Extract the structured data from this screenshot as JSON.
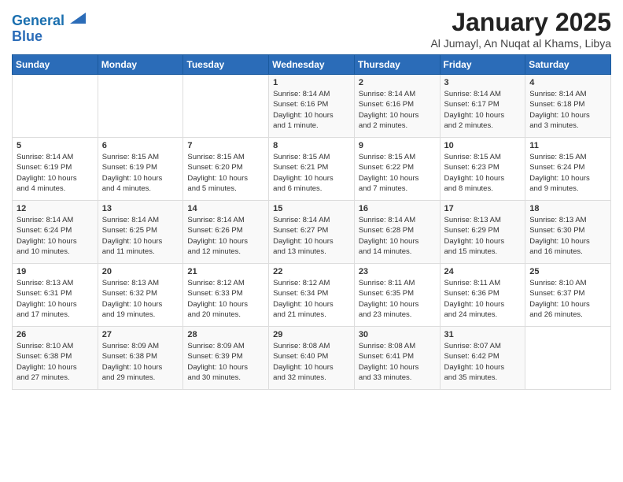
{
  "logo": {
    "line1": "General",
    "line2": "Blue"
  },
  "title": "January 2025",
  "subtitle": "Al Jumayl, An Nuqat al Khams, Libya",
  "days_of_week": [
    "Sunday",
    "Monday",
    "Tuesday",
    "Wednesday",
    "Thursday",
    "Friday",
    "Saturday"
  ],
  "weeks": [
    [
      {
        "day": "",
        "info": ""
      },
      {
        "day": "",
        "info": ""
      },
      {
        "day": "",
        "info": ""
      },
      {
        "day": "1",
        "info": "Sunrise: 8:14 AM\nSunset: 6:16 PM\nDaylight: 10 hours\nand 1 minute."
      },
      {
        "day": "2",
        "info": "Sunrise: 8:14 AM\nSunset: 6:16 PM\nDaylight: 10 hours\nand 2 minutes."
      },
      {
        "day": "3",
        "info": "Sunrise: 8:14 AM\nSunset: 6:17 PM\nDaylight: 10 hours\nand 2 minutes."
      },
      {
        "day": "4",
        "info": "Sunrise: 8:14 AM\nSunset: 6:18 PM\nDaylight: 10 hours\nand 3 minutes."
      }
    ],
    [
      {
        "day": "5",
        "info": "Sunrise: 8:14 AM\nSunset: 6:19 PM\nDaylight: 10 hours\nand 4 minutes."
      },
      {
        "day": "6",
        "info": "Sunrise: 8:15 AM\nSunset: 6:19 PM\nDaylight: 10 hours\nand 4 minutes."
      },
      {
        "day": "7",
        "info": "Sunrise: 8:15 AM\nSunset: 6:20 PM\nDaylight: 10 hours\nand 5 minutes."
      },
      {
        "day": "8",
        "info": "Sunrise: 8:15 AM\nSunset: 6:21 PM\nDaylight: 10 hours\nand 6 minutes."
      },
      {
        "day": "9",
        "info": "Sunrise: 8:15 AM\nSunset: 6:22 PM\nDaylight: 10 hours\nand 7 minutes."
      },
      {
        "day": "10",
        "info": "Sunrise: 8:15 AM\nSunset: 6:23 PM\nDaylight: 10 hours\nand 8 minutes."
      },
      {
        "day": "11",
        "info": "Sunrise: 8:15 AM\nSunset: 6:24 PM\nDaylight: 10 hours\nand 9 minutes."
      }
    ],
    [
      {
        "day": "12",
        "info": "Sunrise: 8:14 AM\nSunset: 6:24 PM\nDaylight: 10 hours\nand 10 minutes."
      },
      {
        "day": "13",
        "info": "Sunrise: 8:14 AM\nSunset: 6:25 PM\nDaylight: 10 hours\nand 11 minutes."
      },
      {
        "day": "14",
        "info": "Sunrise: 8:14 AM\nSunset: 6:26 PM\nDaylight: 10 hours\nand 12 minutes."
      },
      {
        "day": "15",
        "info": "Sunrise: 8:14 AM\nSunset: 6:27 PM\nDaylight: 10 hours\nand 13 minutes."
      },
      {
        "day": "16",
        "info": "Sunrise: 8:14 AM\nSunset: 6:28 PM\nDaylight: 10 hours\nand 14 minutes."
      },
      {
        "day": "17",
        "info": "Sunrise: 8:13 AM\nSunset: 6:29 PM\nDaylight: 10 hours\nand 15 minutes."
      },
      {
        "day": "18",
        "info": "Sunrise: 8:13 AM\nSunset: 6:30 PM\nDaylight: 10 hours\nand 16 minutes."
      }
    ],
    [
      {
        "day": "19",
        "info": "Sunrise: 8:13 AM\nSunset: 6:31 PM\nDaylight: 10 hours\nand 17 minutes."
      },
      {
        "day": "20",
        "info": "Sunrise: 8:13 AM\nSunset: 6:32 PM\nDaylight: 10 hours\nand 19 minutes."
      },
      {
        "day": "21",
        "info": "Sunrise: 8:12 AM\nSunset: 6:33 PM\nDaylight: 10 hours\nand 20 minutes."
      },
      {
        "day": "22",
        "info": "Sunrise: 8:12 AM\nSunset: 6:34 PM\nDaylight: 10 hours\nand 21 minutes."
      },
      {
        "day": "23",
        "info": "Sunrise: 8:11 AM\nSunset: 6:35 PM\nDaylight: 10 hours\nand 23 minutes."
      },
      {
        "day": "24",
        "info": "Sunrise: 8:11 AM\nSunset: 6:36 PM\nDaylight: 10 hours\nand 24 minutes."
      },
      {
        "day": "25",
        "info": "Sunrise: 8:10 AM\nSunset: 6:37 PM\nDaylight: 10 hours\nand 26 minutes."
      }
    ],
    [
      {
        "day": "26",
        "info": "Sunrise: 8:10 AM\nSunset: 6:38 PM\nDaylight: 10 hours\nand 27 minutes."
      },
      {
        "day": "27",
        "info": "Sunrise: 8:09 AM\nSunset: 6:38 PM\nDaylight: 10 hours\nand 29 minutes."
      },
      {
        "day": "28",
        "info": "Sunrise: 8:09 AM\nSunset: 6:39 PM\nDaylight: 10 hours\nand 30 minutes."
      },
      {
        "day": "29",
        "info": "Sunrise: 8:08 AM\nSunset: 6:40 PM\nDaylight: 10 hours\nand 32 minutes."
      },
      {
        "day": "30",
        "info": "Sunrise: 8:08 AM\nSunset: 6:41 PM\nDaylight: 10 hours\nand 33 minutes."
      },
      {
        "day": "31",
        "info": "Sunrise: 8:07 AM\nSunset: 6:42 PM\nDaylight: 10 hours\nand 35 minutes."
      },
      {
        "day": "",
        "info": ""
      }
    ]
  ]
}
